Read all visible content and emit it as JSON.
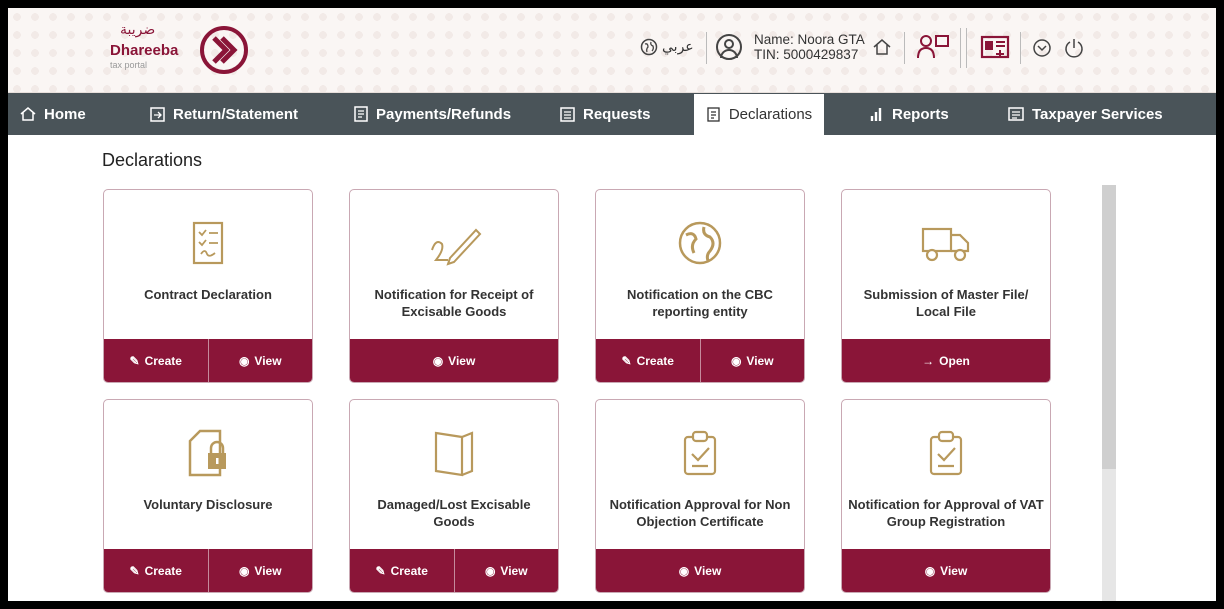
{
  "header": {
    "logo_arabic": "ضريبة",
    "logo_name": "Dhareeba",
    "logo_sub": "tax portal",
    "language_label": "عربي",
    "user_name": "Name: Noora GTA",
    "user_tin": "TIN: 5000429837"
  },
  "nav": {
    "items": [
      {
        "label": "Home",
        "icon": "home-icon"
      },
      {
        "label": "Return/Statement",
        "icon": "return-icon"
      },
      {
        "label": "Payments/Refunds",
        "icon": "payments-icon"
      },
      {
        "label": "Requests",
        "icon": "requests-icon"
      },
      {
        "label": "Declarations",
        "icon": "declarations-icon",
        "active": true
      },
      {
        "label": "Reports",
        "icon": "reports-icon"
      },
      {
        "label": "Taxpayer Services",
        "icon": "taxpayer-services-icon"
      }
    ]
  },
  "page_title": "Declarations",
  "colors": {
    "brand": "#8a1538",
    "gold": "#b8995c",
    "nav": "#4a5459"
  },
  "cards": [
    {
      "title": "Contract Declaration",
      "icon": "contract-checklist-icon",
      "actions": [
        "Create",
        "View"
      ]
    },
    {
      "title": "Notification for Receipt of Excisable Goods",
      "icon": "signature-pen-icon",
      "actions": [
        "View"
      ]
    },
    {
      "title": "Notification on the CBC reporting entity",
      "icon": "globe-icon",
      "actions": [
        "Create",
        "View"
      ]
    },
    {
      "title": "Submission of Master File/ Local File",
      "icon": "truck-icon",
      "actions": [
        "Open"
      ]
    },
    {
      "title": "Voluntary Disclosure",
      "icon": "locked-file-icon",
      "actions": [
        "Create",
        "View"
      ]
    },
    {
      "title": "Damaged/Lost Excisable Goods",
      "icon": "book-icon",
      "actions": [
        "Create",
        "View"
      ]
    },
    {
      "title": "Notification Approval for Non Objection Certificate",
      "icon": "clipboard-check-icon",
      "actions": [
        "View"
      ]
    },
    {
      "title": "Notification for Approval of VAT Group Registration",
      "icon": "clipboard-check-icon",
      "actions": [
        "View"
      ]
    }
  ]
}
